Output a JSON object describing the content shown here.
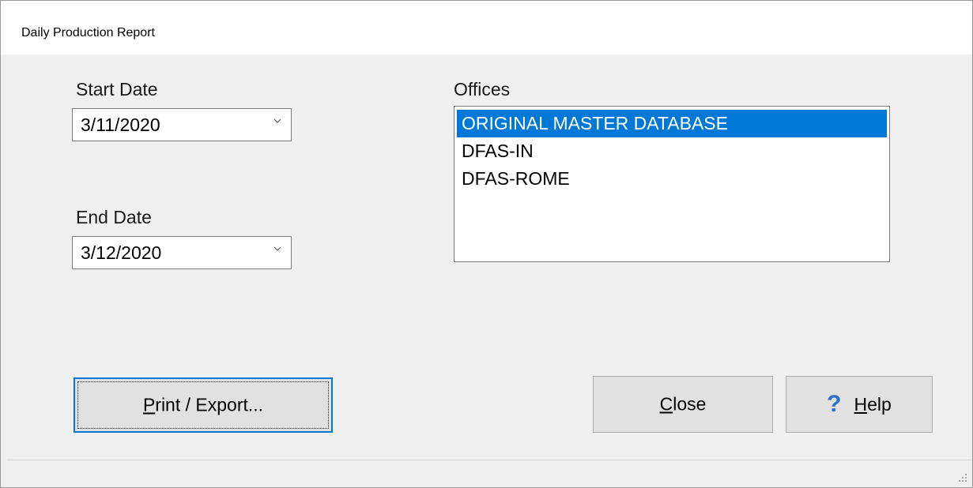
{
  "window": {
    "title": "Daily Production Report"
  },
  "start_date": {
    "label": "Start Date",
    "value": "3/11/2020"
  },
  "end_date": {
    "label": "End Date",
    "value": "3/12/2020"
  },
  "offices": {
    "label": "Offices",
    "items": [
      {
        "label": "ORIGINAL MASTER DATABASE",
        "selected": true
      },
      {
        "label": "DFAS-IN",
        "selected": false
      },
      {
        "label": "DFAS-ROME",
        "selected": false
      }
    ]
  },
  "buttons": {
    "print_export": {
      "label": "Print / Export...",
      "accel": "P",
      "rest": "rint / Export..."
    },
    "close": {
      "label": "Close",
      "accel": "C",
      "rest": "lose"
    },
    "help": {
      "label": "Help",
      "accel": "H",
      "rest": "elp",
      "icon": "?"
    }
  },
  "colors": {
    "selection": "#0078d7",
    "help_icon": "#2b71c9"
  }
}
